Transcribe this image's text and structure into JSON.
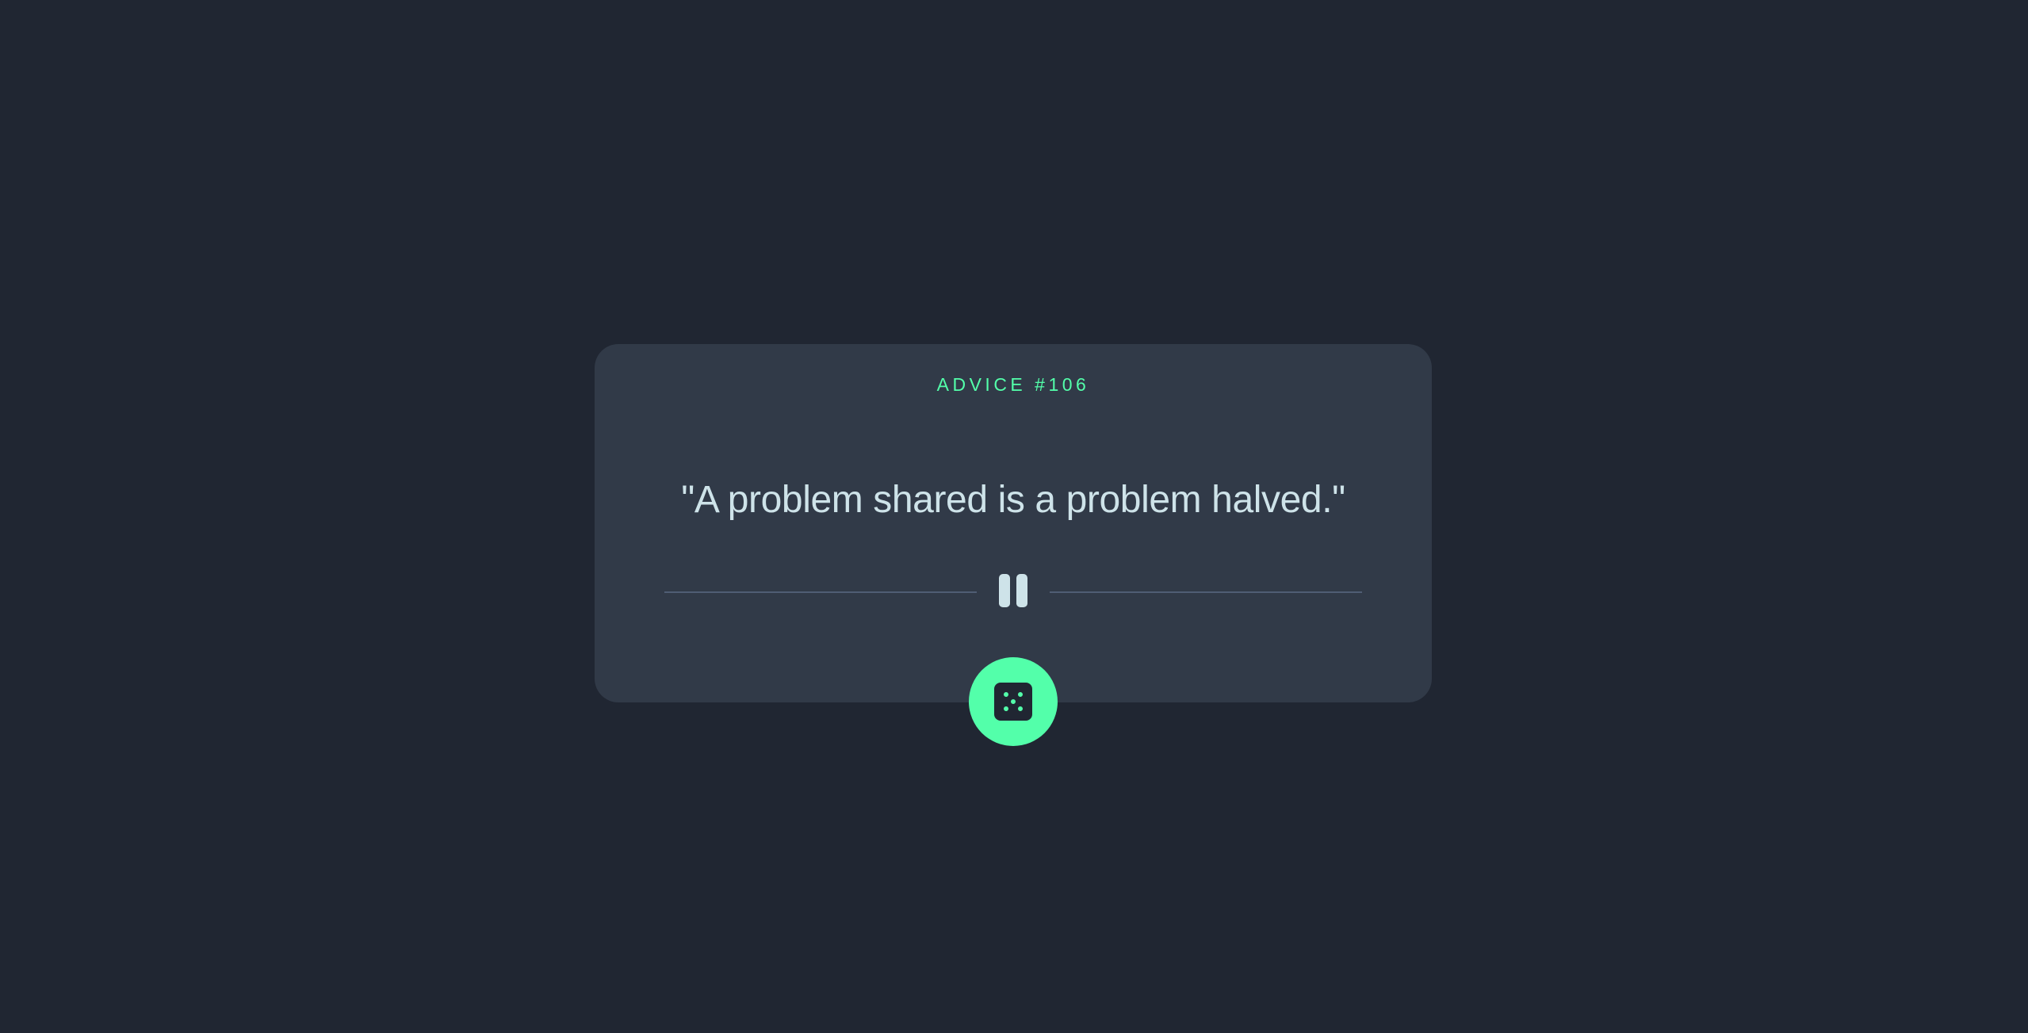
{
  "advice": {
    "label": "ADVICE #106",
    "quote": "\"A problem shared is a problem halved.\""
  },
  "icons": {
    "divider_icon": "pause-icon",
    "button_icon": "dice-icon"
  },
  "colors": {
    "background": "#202632",
    "card": "#313a48",
    "accent": "#53ffaa",
    "text": "#cee3e9",
    "divider": "#4f5d74"
  }
}
